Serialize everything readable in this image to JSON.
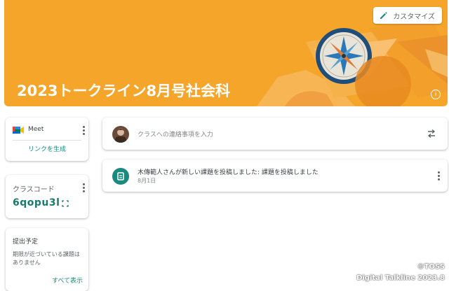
{
  "banner": {
    "title": "2023トークライン8月号社会科",
    "customize_label": "カスタマイズ",
    "info_icon": "info-icon",
    "color": "#f4a52a"
  },
  "meet": {
    "label": "Meet",
    "link": "リンクを生成"
  },
  "class_code": {
    "label": "クラスコード",
    "value": "6qopu3l"
  },
  "upcoming": {
    "title": "提出予定",
    "text": "期限が近づいている課題はありません",
    "view_all": "すべて表示"
  },
  "announce": {
    "placeholder": "クラスへの連絡事項を入力"
  },
  "post": {
    "title": "木傳範人さんが新しい課題を投稿しました: 課題を投稿しました",
    "date": "8月1日"
  },
  "watermark": {
    "line1": "©TOSS",
    "line2": "Digital Talkline 2023.8"
  },
  "colors": {
    "accent": "#1a8a7e",
    "banner": "#f4a52a"
  }
}
